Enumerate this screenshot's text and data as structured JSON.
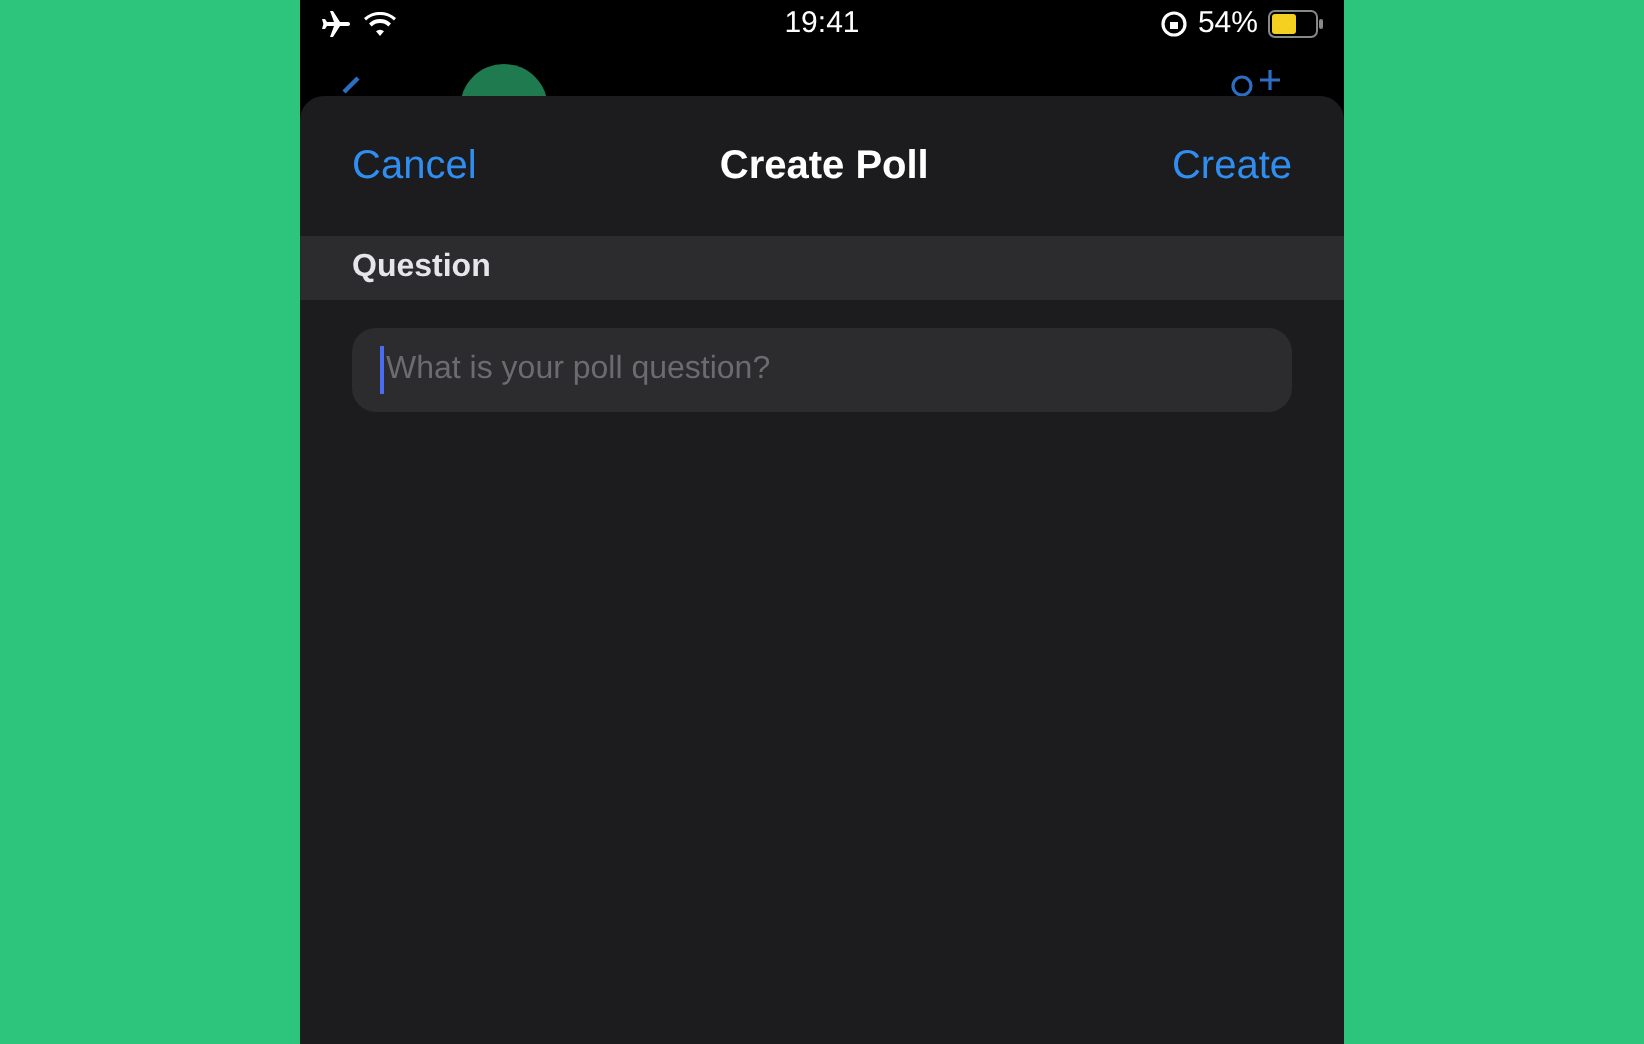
{
  "status_bar": {
    "time": "19:41",
    "battery": "54%"
  },
  "sheet": {
    "cancel": "Cancel",
    "title": "Create Poll",
    "confirm": "Create"
  },
  "section_header": "Question",
  "question_field": {
    "placeholder": "What is your poll question?"
  }
}
